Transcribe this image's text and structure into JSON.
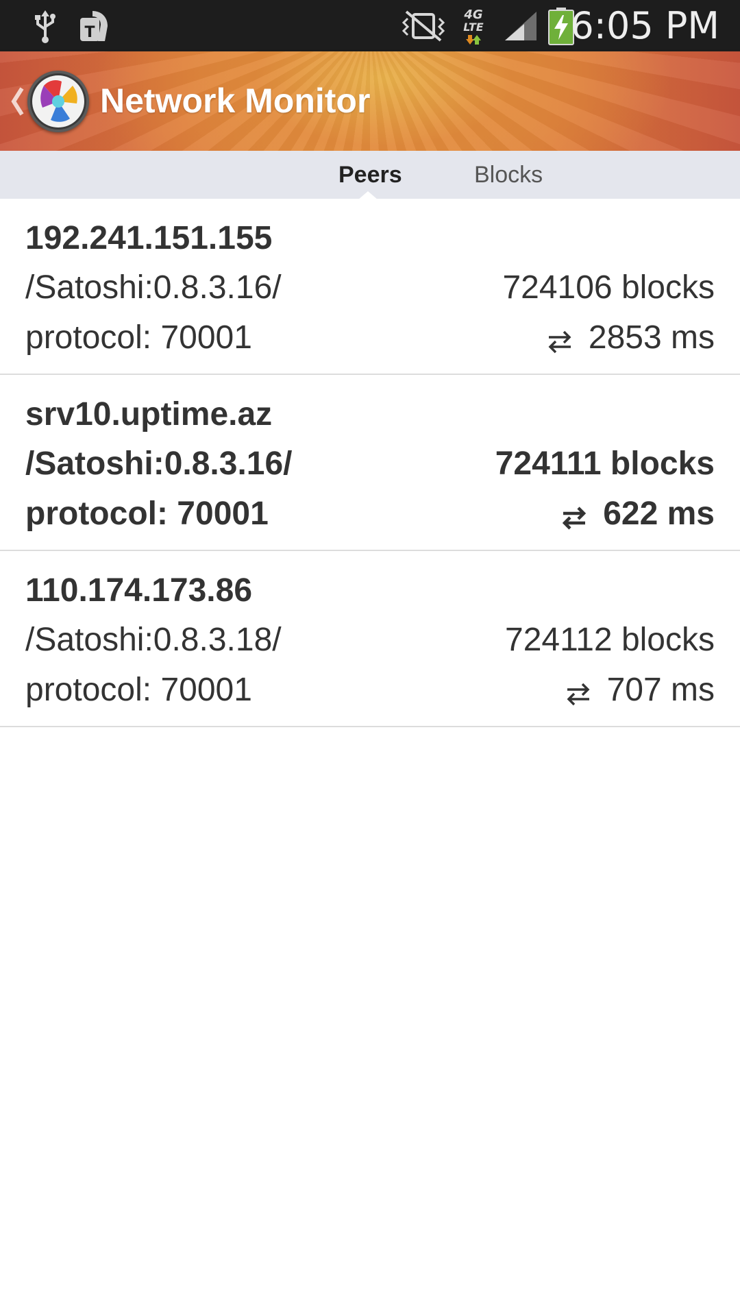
{
  "status_bar": {
    "time": "6:05 PM",
    "icons": [
      "usb-icon",
      "tmobile-icon",
      "vibrate-off-icon",
      "lte-4g-icon",
      "signal-icon",
      "battery-charging-icon"
    ],
    "network_label_top": "4G",
    "network_label_bottom": "LTE",
    "carrier_letter": "T"
  },
  "action_bar": {
    "title": "Network Monitor"
  },
  "tabs": [
    {
      "label": "Peers",
      "active": true
    },
    {
      "label": "Blocks",
      "active": false
    }
  ],
  "peers": [
    {
      "host": "192.241.151.155",
      "agent": "/Satoshi:0.8.3.16/",
      "protocol": "protocol: 70001",
      "blocks": "724106 blocks",
      "ping": "2853 ms",
      "bold": false
    },
    {
      "host": "srv10.uptime.az",
      "agent": "/Satoshi:0.8.3.16/",
      "protocol": "protocol: 70001",
      "blocks": "724111 blocks",
      "ping": "622 ms",
      "bold": true
    },
    {
      "host": "110.174.173.86",
      "agent": "/Satoshi:0.8.3.18/",
      "protocol": "protocol: 70001",
      "blocks": "724112 blocks",
      "ping": "707 ms",
      "bold": false
    }
  ],
  "colors": {
    "status_bar": "#1d1d1d",
    "tab_strip": "#e4e6ed",
    "text": "#333333",
    "divider": "#dcdcdc"
  }
}
